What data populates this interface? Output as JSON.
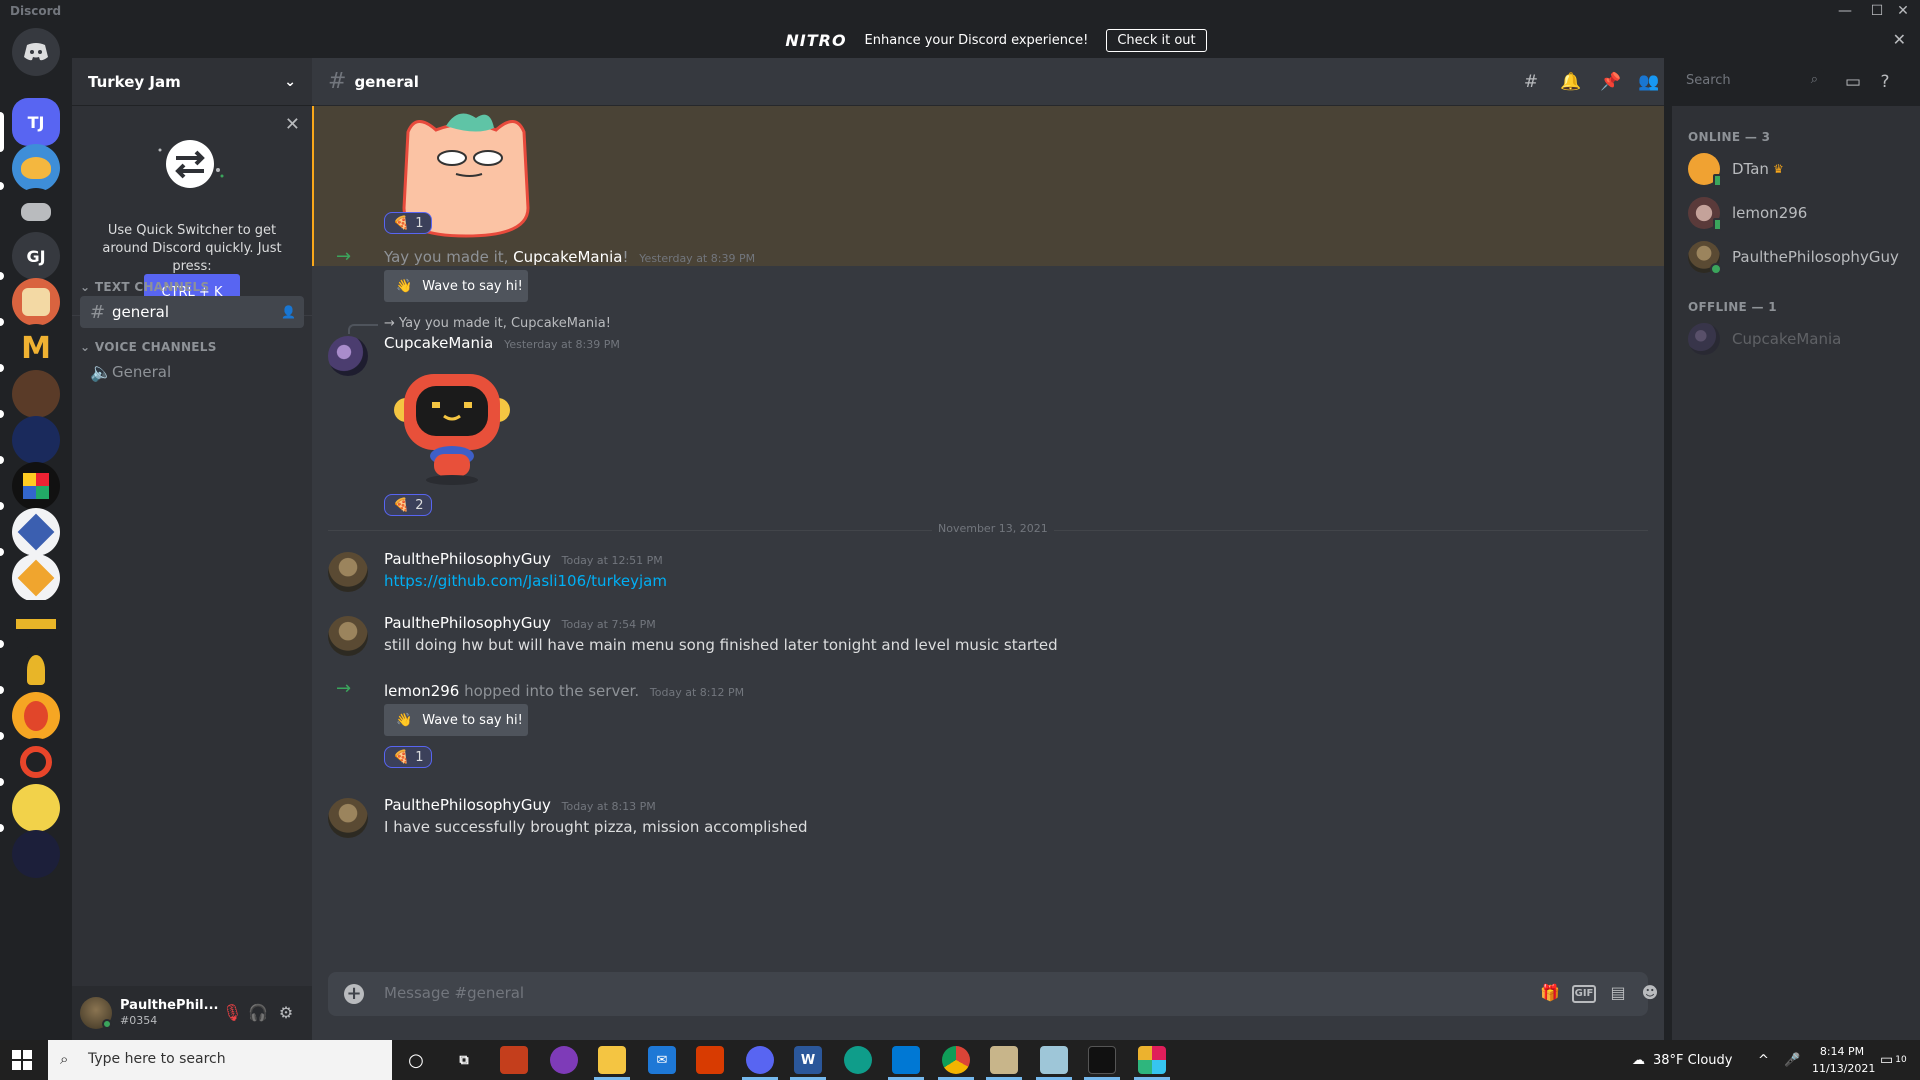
{
  "window": {
    "app_title": "Discord",
    "controls": [
      "—",
      "☐",
      "✕"
    ]
  },
  "nitro_banner": {
    "brand": "NITRO",
    "message": "Enhance your Discord experience!",
    "cta": "Check it out",
    "close": "✕"
  },
  "servers": [
    {
      "label": "TJ",
      "color": "#5865f2"
    },
    {
      "label": "GJ",
      "color": "#36393f"
    }
  ],
  "guild": {
    "name": "Turkey Jam",
    "chevron": "⌄"
  },
  "quick_switcher": {
    "close": "✕",
    "text": "Use Quick Switcher to get around Discord quickly. Just press:",
    "shortcut": "CTRL + K"
  },
  "categories": {
    "text": "TEXT CHANNELS",
    "voice": "VOICE CHANNELS"
  },
  "channels": {
    "text_general": "general",
    "voice_general": "General"
  },
  "user_panel": {
    "name": "PaulthePhil...",
    "tag": "#0354"
  },
  "channel_header": {
    "name": "general",
    "search_placeholder": "Search"
  },
  "messages": {
    "reaction1_count": "1",
    "join1": {
      "prefix": "Yay you made it, ",
      "user": "CupcakeMania",
      "suffix": "!",
      "time": "Yesterday at 8:39 PM",
      "wave": "Wave to say hi!"
    },
    "reply_preview": "Yay you made it, CupcakeMania!",
    "msg_cm": {
      "user": "CupcakeMania",
      "time": "Yesterday at 8:39 PM",
      "reaction_count": "2"
    },
    "date_divider": "November 13, 2021",
    "msg1": {
      "user": "PaulthePhilosophyGuy",
      "time": "Today at 12:51 PM",
      "text": "https://github.com/Jasli106/turkeyjam"
    },
    "msg2": {
      "user": "PaulthePhilosophyGuy",
      "time": "Today at 7:54 PM",
      "text": "still doing hw but will have main menu song finished later tonight and level music started"
    },
    "join2": {
      "user": "lemon296",
      "text": " hopped into the server.",
      "time": "Today at 8:12 PM",
      "wave": "Wave to say hi!",
      "reaction_count": "1"
    },
    "msg3": {
      "user": "PaulthePhilosophyGuy",
      "time": "Today at 8:13 PM",
      "text": "I have successfully brought pizza, mission accomplished"
    }
  },
  "composer": {
    "placeholder": "Message #general",
    "gif": "GIF"
  },
  "members": {
    "online_header": "ONLINE — 3",
    "offline_header": "OFFLINE — 1",
    "online": [
      "DTan",
      "lemon296",
      "PaulthePhilosophyGuy"
    ],
    "offline": [
      "CupcakeMania"
    ]
  },
  "taskbar": {
    "search_placeholder": "Type here to search",
    "weather": "38°F  Cloudy",
    "time": "8:14 PM",
    "date": "11/13/2021",
    "notifications": "10"
  }
}
